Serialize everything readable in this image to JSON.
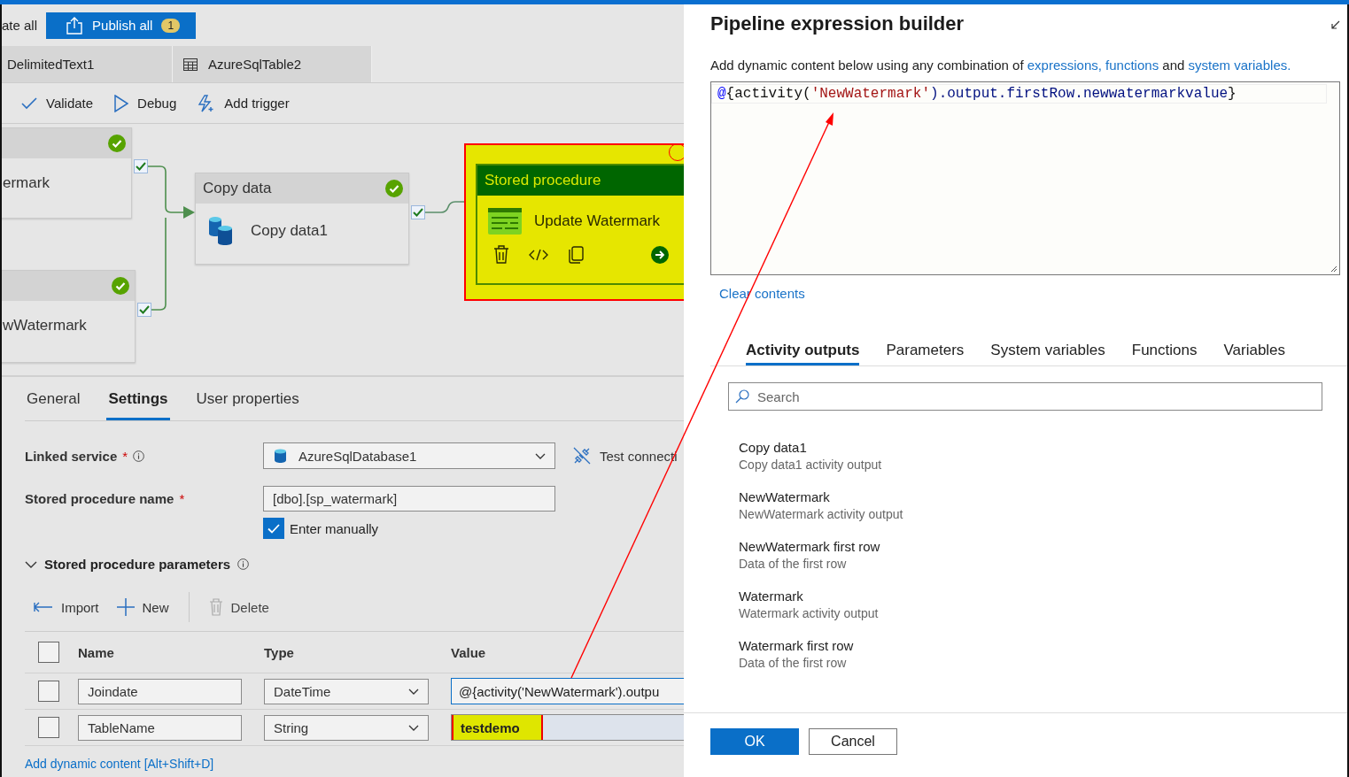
{
  "top_bar": {
    "partial_button": "ate all",
    "publish_button": {
      "label": "Publish all",
      "badge": "1"
    }
  },
  "file_tabs": [
    {
      "label": "DelimitedText1",
      "kind": "plain"
    },
    {
      "label": "AzureSqlTable2",
      "kind": "table"
    }
  ],
  "toolbar": [
    {
      "label": "Validate",
      "kind": "check"
    },
    {
      "label": "Debug",
      "kind": "play"
    },
    {
      "label": "Add trigger",
      "kind": "trigger"
    }
  ],
  "canvas": {
    "nodes": [
      {
        "kind": "lookup",
        "name": "ermark",
        "succeeded": true,
        "selected": false,
        "highlighted": false
      },
      {
        "kind": "lookup",
        "name": "wWatermark",
        "succeeded": true,
        "selected": false,
        "highlighted": false
      },
      {
        "kind": "copy",
        "type": "Copy data",
        "name": "Copy data1",
        "succeeded": true,
        "selected": false,
        "highlighted": false
      },
      {
        "kind": "stored_procedure",
        "type": "Stored procedure",
        "name": "Update Watermark",
        "succeeded": false,
        "selected": true,
        "highlighted": true
      }
    ]
  },
  "details": {
    "tabs": [
      {
        "label": "General",
        "selected": false
      },
      {
        "label": "Settings",
        "selected": true
      },
      {
        "label": "User properties",
        "selected": false
      }
    ],
    "linked_service": {
      "label": "Linked service",
      "required_mark": "*",
      "value": "AzureSqlDatabase1",
      "test_connection": "Test connecti"
    },
    "procedure_name": {
      "label": "Stored procedure name",
      "required_mark": "*",
      "value": "[dbo].[sp_watermark]"
    },
    "enter_manually": {
      "label": "Enter manually",
      "checked": true
    },
    "parameters": {
      "label": "Stored procedure parameters",
      "expanded": true,
      "actions": [
        {
          "label": "Import",
          "kind": "import",
          "disabled": false
        },
        {
          "label": "New",
          "kind": "new",
          "disabled": false
        },
        {
          "label": "Delete",
          "kind": "delete",
          "disabled": true
        }
      ],
      "all_selected": false,
      "columns": [
        "Name",
        "Type",
        "Value"
      ],
      "rows": [
        {
          "selected": false,
          "name": "Joindate",
          "type": "DateTime",
          "value": "@{activity('NewWatermark').outpu",
          "focused": true,
          "highlighted": false
        },
        {
          "selected": false,
          "name": "TableName",
          "type": "String",
          "value": "testdemo",
          "focused": false,
          "highlighted": true
        }
      ]
    },
    "dynamic_link": "Add dynamic content [Alt+Shift+D]"
  },
  "builder": {
    "title": "Pipeline expression builder",
    "description": [
      {
        "text": "Add dynamic content below using any combination of ",
        "kind": "text"
      },
      {
        "text": "expressions, functions",
        "kind": "link"
      },
      {
        "text": " and ",
        "kind": "text"
      },
      {
        "text": "system variables.",
        "kind": "link"
      }
    ],
    "expression": [
      {
        "text": "@",
        "kind": "at"
      },
      {
        "text": "{activity(",
        "kind": "plain"
      },
      {
        "text": "'NewWatermark'",
        "kind": "string"
      },
      {
        "text": ").output.firstRow.newwatermarkvalue",
        "kind": "member"
      },
      {
        "text": "}",
        "kind": "plain"
      }
    ],
    "clear_link": "Clear contents",
    "tabs": [
      {
        "label": "Activity outputs",
        "selected": true
      },
      {
        "label": "Parameters",
        "selected": false
      },
      {
        "label": "System variables",
        "selected": false
      },
      {
        "label": "Functions",
        "selected": false
      },
      {
        "label": "Variables",
        "selected": false
      }
    ],
    "search": {
      "placeholder": "Search"
    },
    "items": [
      {
        "title": "Copy data1",
        "subtitle": "Copy data1 activity output"
      },
      {
        "title": "NewWatermark",
        "subtitle": "NewWatermark activity output"
      },
      {
        "title": "NewWatermark first row",
        "subtitle": "Data of the first row"
      },
      {
        "title": "Watermark",
        "subtitle": "Watermark activity output"
      },
      {
        "title": "Watermark first row",
        "subtitle": "Data of the first row"
      }
    ],
    "buttons": [
      {
        "label": "OK",
        "kind": "primary"
      },
      {
        "label": "Cancel",
        "kind": "secondary"
      }
    ]
  }
}
